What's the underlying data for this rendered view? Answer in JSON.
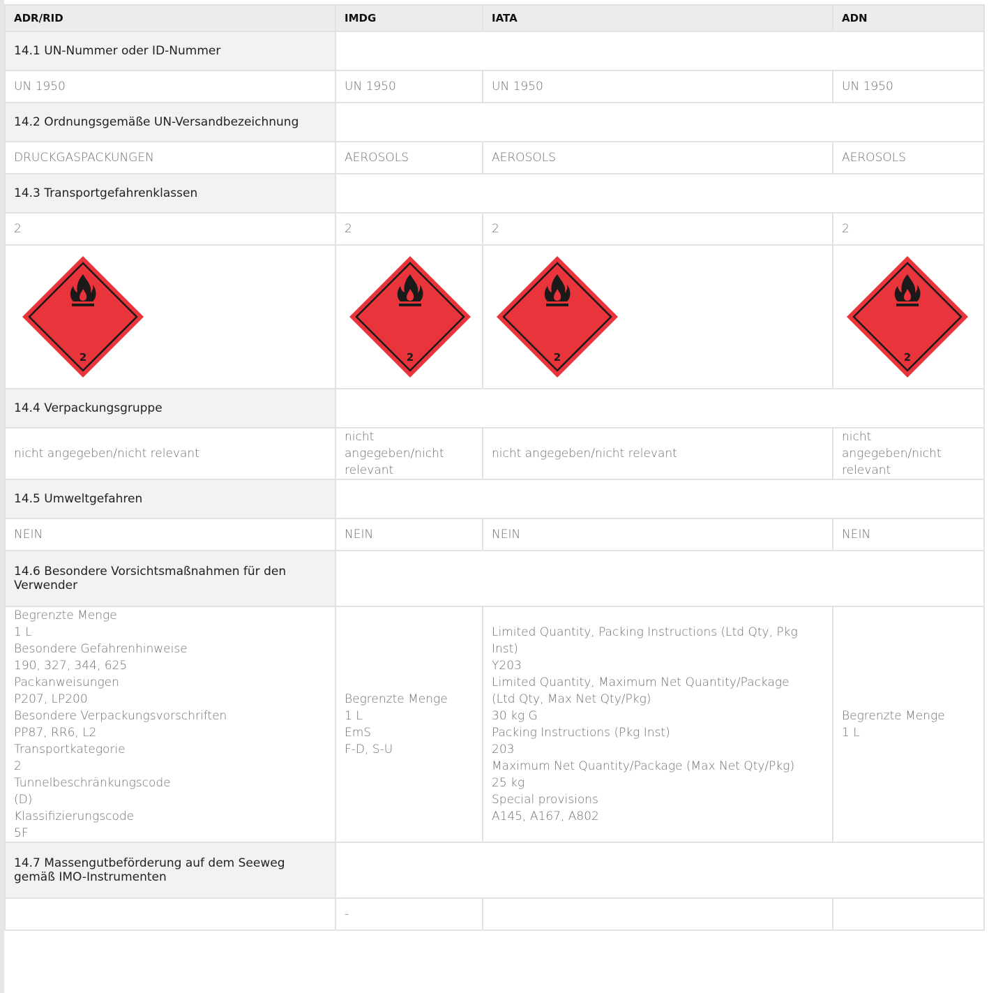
{
  "columns": [
    "ADR/RID",
    "IMDG",
    "IATA",
    "ADN"
  ],
  "sections": {
    "s141": "14.1 UN-Nummer oder ID-Nummer",
    "s142": "14.2 Ordnungsgemäße UN-Versandbezeichnung",
    "s143": "14.3 Transportgefahrenklassen",
    "s144": "14.4 Verpackungsgruppe",
    "s145": "14.5 Umweltgefahren",
    "s146_l1": "14.6 Besondere Vorsichtsmaßnahmen für den",
    "s146_l2": "Verwender",
    "s147_l1": "14.7 Massengutbeförderung auf dem Seeweg",
    "s147_l2": "gemäß IMO-Instrumenten"
  },
  "un_number": [
    "UN 1950",
    "UN 1950",
    "UN 1950",
    "UN 1950"
  ],
  "shipping_name": [
    "DRUCKGASPACKUNGEN",
    "AEROSOLS",
    "AEROSOLS",
    "AEROSOLS"
  ],
  "hazard_class": [
    "2",
    "2",
    "2",
    "2"
  ],
  "hazard_label": {
    "number": "2",
    "icon": "flame-icon",
    "color": "#e8343a",
    "border": "#1a1a1a"
  },
  "packing_group": {
    "adr": "nicht angegeben/nicht relevant",
    "imdg": [
      "nicht",
      "angegeben/nicht",
      "relevant"
    ],
    "iata": "nicht angegeben/nicht relevant",
    "adn": [
      "nicht",
      "angegeben/nicht",
      "relevant"
    ]
  },
  "environment": [
    "NEIN",
    "NEIN",
    "NEIN",
    "NEIN"
  ],
  "precautions": {
    "adr": [
      "Begrenzte Menge",
      "1 L",
      "Besondere Gefahrenhinweise",
      "190, 327, 344, 625",
      "Packanweisungen",
      "P207, LP200",
      "Besondere Verpackungsvorschriften",
      "PP87, RR6, L2",
      "Transportkategorie",
      "2",
      "Tunnelbeschränkungscode",
      "(D)",
      "Klassifizierungscode",
      "5F"
    ],
    "imdg": [
      "Begrenzte Menge",
      "1 L",
      "EmS",
      "F-D, S-U"
    ],
    "iata": [
      "Limited Quantity, Packing Instructions (Ltd Qty, Pkg",
      "Inst)",
      "Y203",
      "Limited Quantity, Maximum Net Quantity/Package",
      "(Ltd Qty, Max Net Qty/Pkg)",
      "30 kg G",
      "Packing Instructions (Pkg Inst)",
      "203",
      "Maximum Net Quantity/Package (Max Net Qty/Pkg)",
      "25 kg",
      "Special provisions",
      "A145, A167, A802"
    ],
    "adn": [
      "Begrenzte Menge",
      "1 L"
    ]
  },
  "bulk": [
    "",
    "-",
    "",
    ""
  ]
}
